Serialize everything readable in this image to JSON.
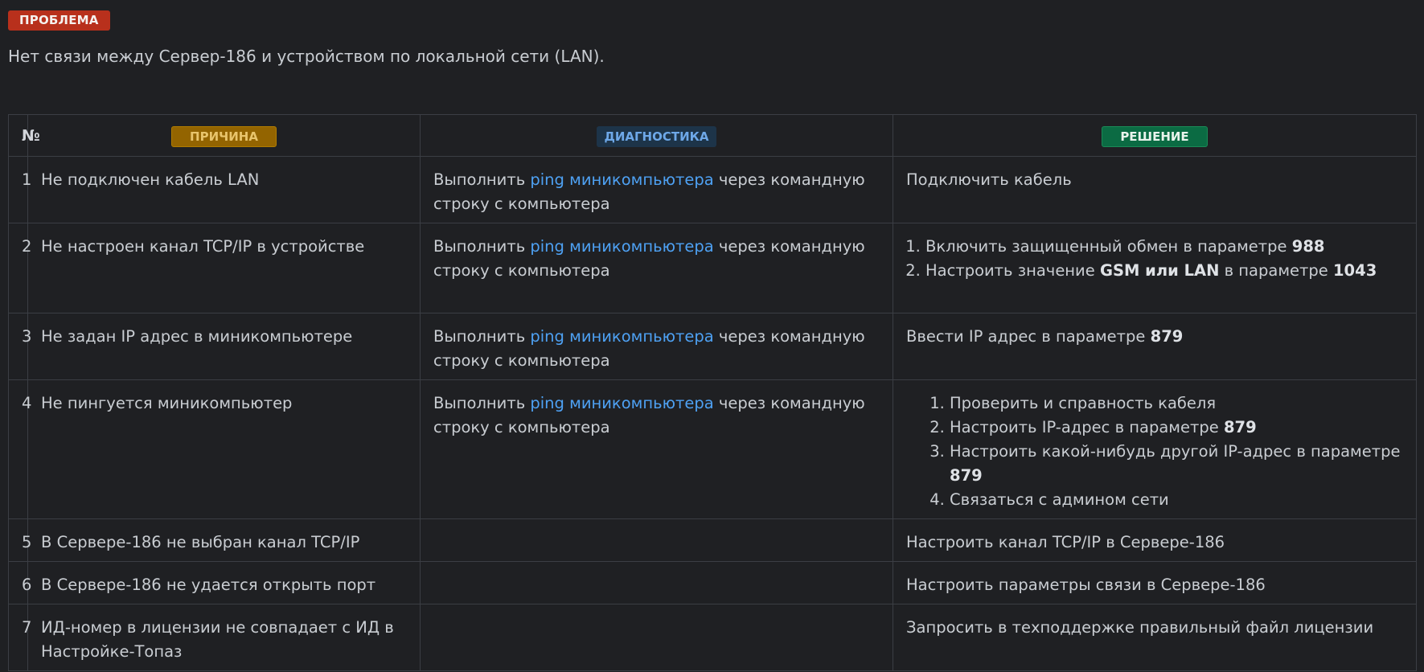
{
  "problem": {
    "badge": "ПРОБЛЕМА",
    "text": "Нет связи между Сервер-186 и устройством по локальной сети (LAN)."
  },
  "table": {
    "headers": {
      "num": "№",
      "cause": "ПРИЧИНА",
      "diagnostics": "ДИАГНОСТИКА",
      "solution": "РЕШЕНИЕ"
    },
    "diag_template": {
      "prefix": "Выполнить ",
      "link": "ping миникомпьютера",
      "suffix": " через командную строку с компьютера"
    },
    "rows": [
      {
        "num": "1",
        "cause": "Не подключен кабель LAN",
        "solution": "Подключить кабель"
      },
      {
        "num": "2",
        "cause": "Не настроен канал TCP/IP в устройстве",
        "solution_list": [
          {
            "text": "Включить защищенный обмен в параметре ",
            "bold": "988"
          },
          {
            "text": "Настроить значение ",
            "bold1": "GSM или LAN",
            "text2": " в параметре ",
            "bold2": "1043"
          }
        ]
      },
      {
        "num": "3",
        "cause": "Не задан IP адрес в миникомпьютере",
        "solution_text": "Ввести IP адрес в параметре ",
        "solution_bold": "879"
      },
      {
        "num": "4",
        "cause": "Не пингуется миникомпьютер",
        "solution_list": [
          {
            "text": "Проверить и справность кабеля"
          },
          {
            "text": "Настроить IP-адрес в параметре ",
            "bold": "879"
          },
          {
            "text": "Настроить какой-нибудь другой IP-адрес в параметре ",
            "bold": "879"
          },
          {
            "text": "Связаться с админом сети"
          }
        ]
      },
      {
        "num": "5",
        "cause": "В Сервере-186 не выбран канал TCP/IP",
        "solution": "Настроить канал TCP/IP в Сервере-186"
      },
      {
        "num": "6",
        "cause": "В Сервере-186 не удается открыть порт",
        "solution": "Настроить параметры связи в Сервере-186"
      },
      {
        "num": "7",
        "cause": "ИД-номер в лицензии не совпадает с ИД в Настройке-Топаз",
        "solution": "Запросить в техподдержке правильный файл лицензии"
      }
    ]
  },
  "colors": {
    "background": "#1f2023",
    "problem_badge": "#b8301c",
    "cause_badge": "#936400",
    "diag_badge": "#1d3449",
    "solution_badge": "#0b6b43",
    "link": "#4ea1f3"
  }
}
